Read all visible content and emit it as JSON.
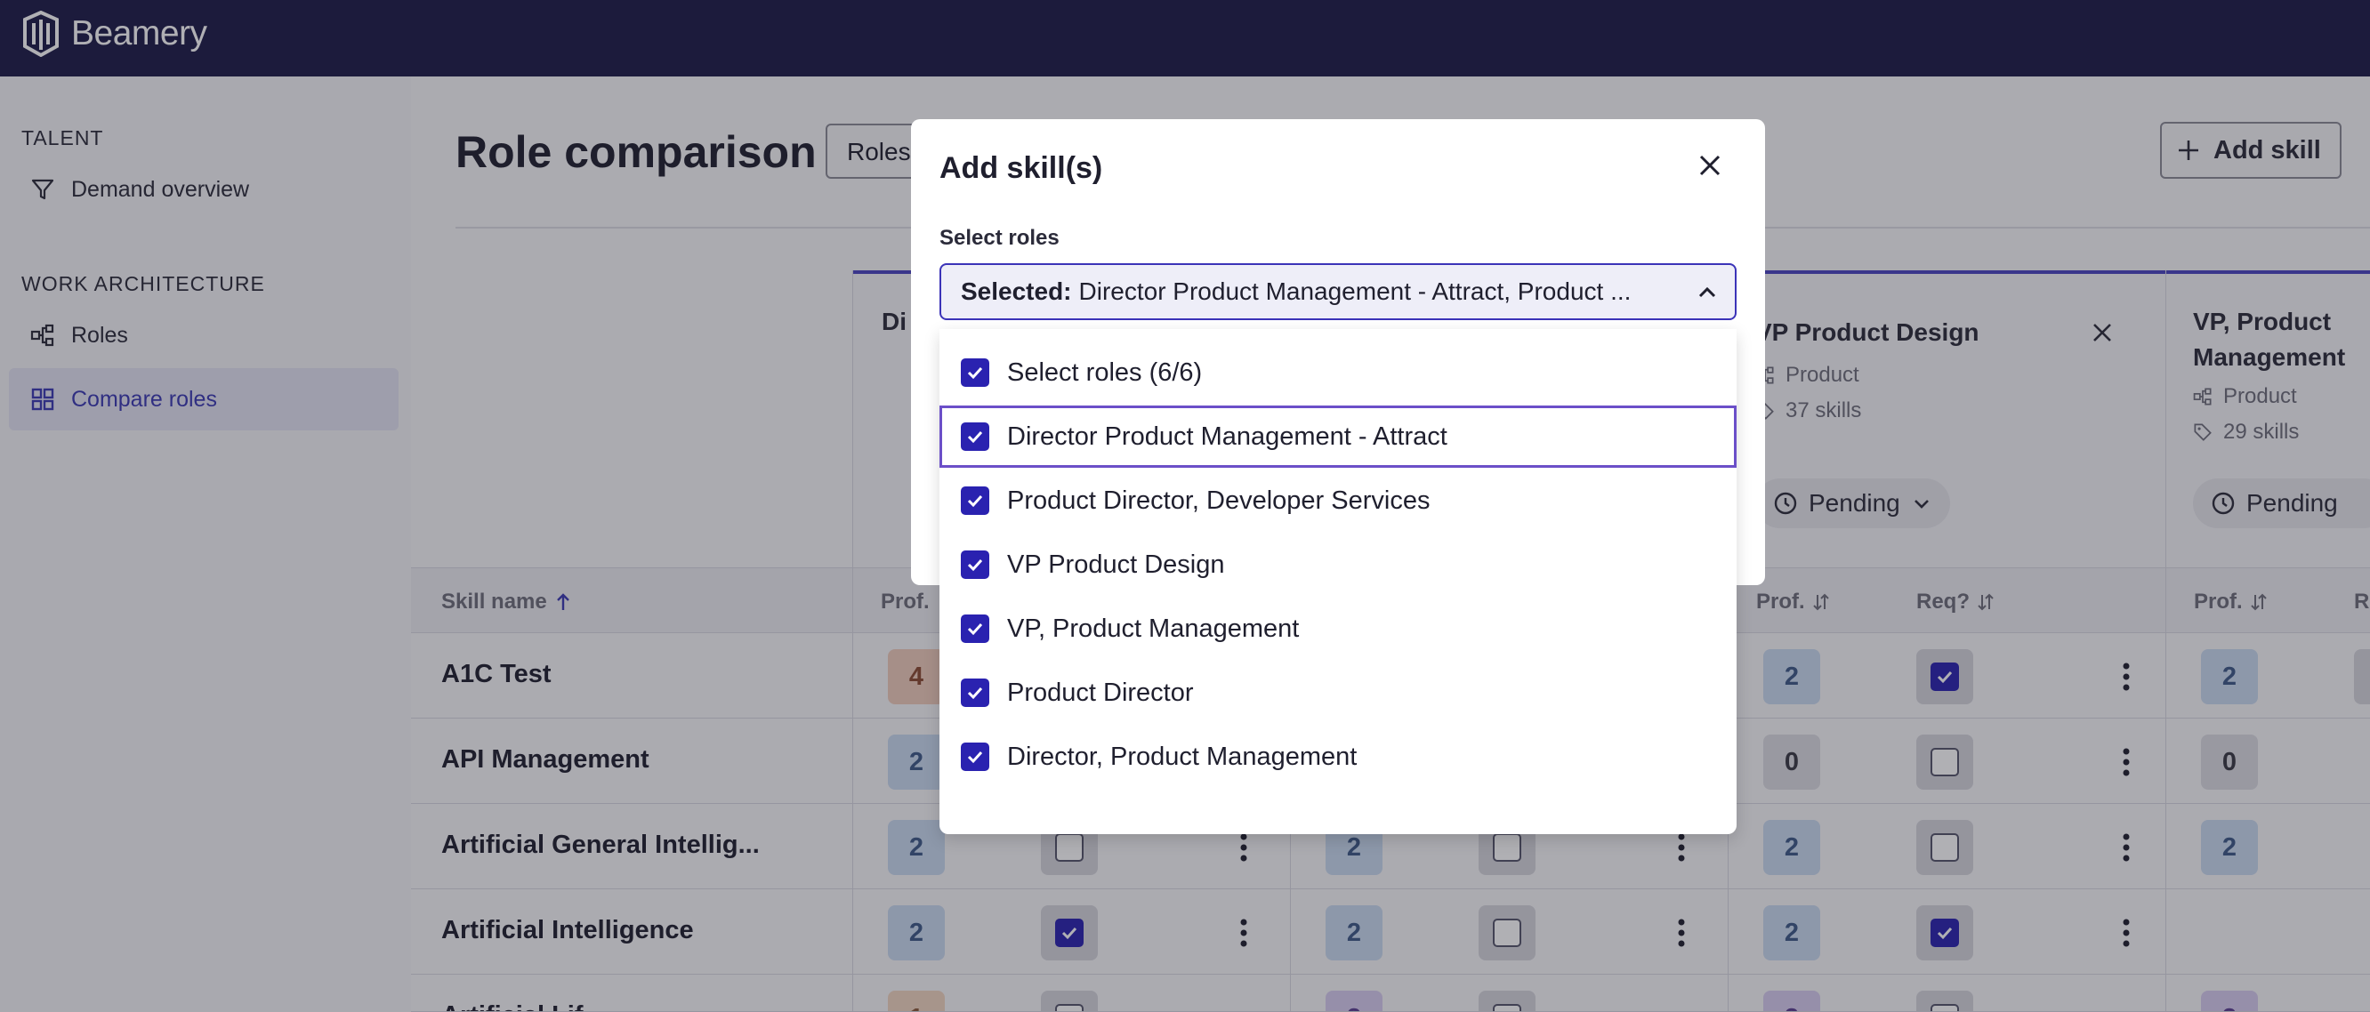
{
  "app": {
    "brand": "Beamery"
  },
  "sidebar": {
    "sections": [
      {
        "heading": "TALENT",
        "items": [
          {
            "label": "Demand overview",
            "icon": "filter-icon"
          }
        ]
      },
      {
        "heading": "WORK ARCHITECTURE",
        "items": [
          {
            "label": "Roles",
            "icon": "hierarchy-icon"
          },
          {
            "label": "Compare roles",
            "icon": "grid-icon",
            "active": true
          }
        ]
      }
    ]
  },
  "page": {
    "title": "Role comparison",
    "roles_button": "Roles",
    "add_skill_button": "Add skill"
  },
  "cards": [
    {
      "title": "Director Product Management - Attract",
      "visible_title": "Di Ma"
    },
    {
      "title": "VP Product Design",
      "dept": "Product",
      "skills": "37 skills",
      "status": "Pending"
    },
    {
      "title": "VP, Product Management",
      "dept": "Product",
      "skills": "29 skills",
      "status": "Pending"
    }
  ],
  "table": {
    "headers": {
      "skill": "Skill name",
      "prof": "Prof.",
      "req": "Req?",
      "r": "R"
    },
    "rows": [
      {
        "name": "A1C Test"
      },
      {
        "name": "API Management"
      },
      {
        "name": "Artificial General Intellig..."
      },
      {
        "name": "Artificial Intelligence"
      },
      {
        "name": "Artificial Lif"
      }
    ]
  },
  "modal": {
    "title": "Add skill(s)",
    "select_label": "Select roles",
    "selected_prefix": "Selected:",
    "selected_value": "Director Product Management - Attract, Product ...",
    "options": [
      {
        "label": "Select roles (6/6)"
      },
      {
        "label": "Director Product Management - Attract"
      },
      {
        "label": "Product Director, Developer Services"
      },
      {
        "label": "VP Product Design"
      },
      {
        "label": "VP, Product Management"
      },
      {
        "label": "Product Director"
      },
      {
        "label": "Director, Product Management"
      }
    ]
  },
  "colors": {
    "topbar": "#1d1b47",
    "accent": "#2a22b0",
    "active_nav": "#e4e4f3"
  }
}
